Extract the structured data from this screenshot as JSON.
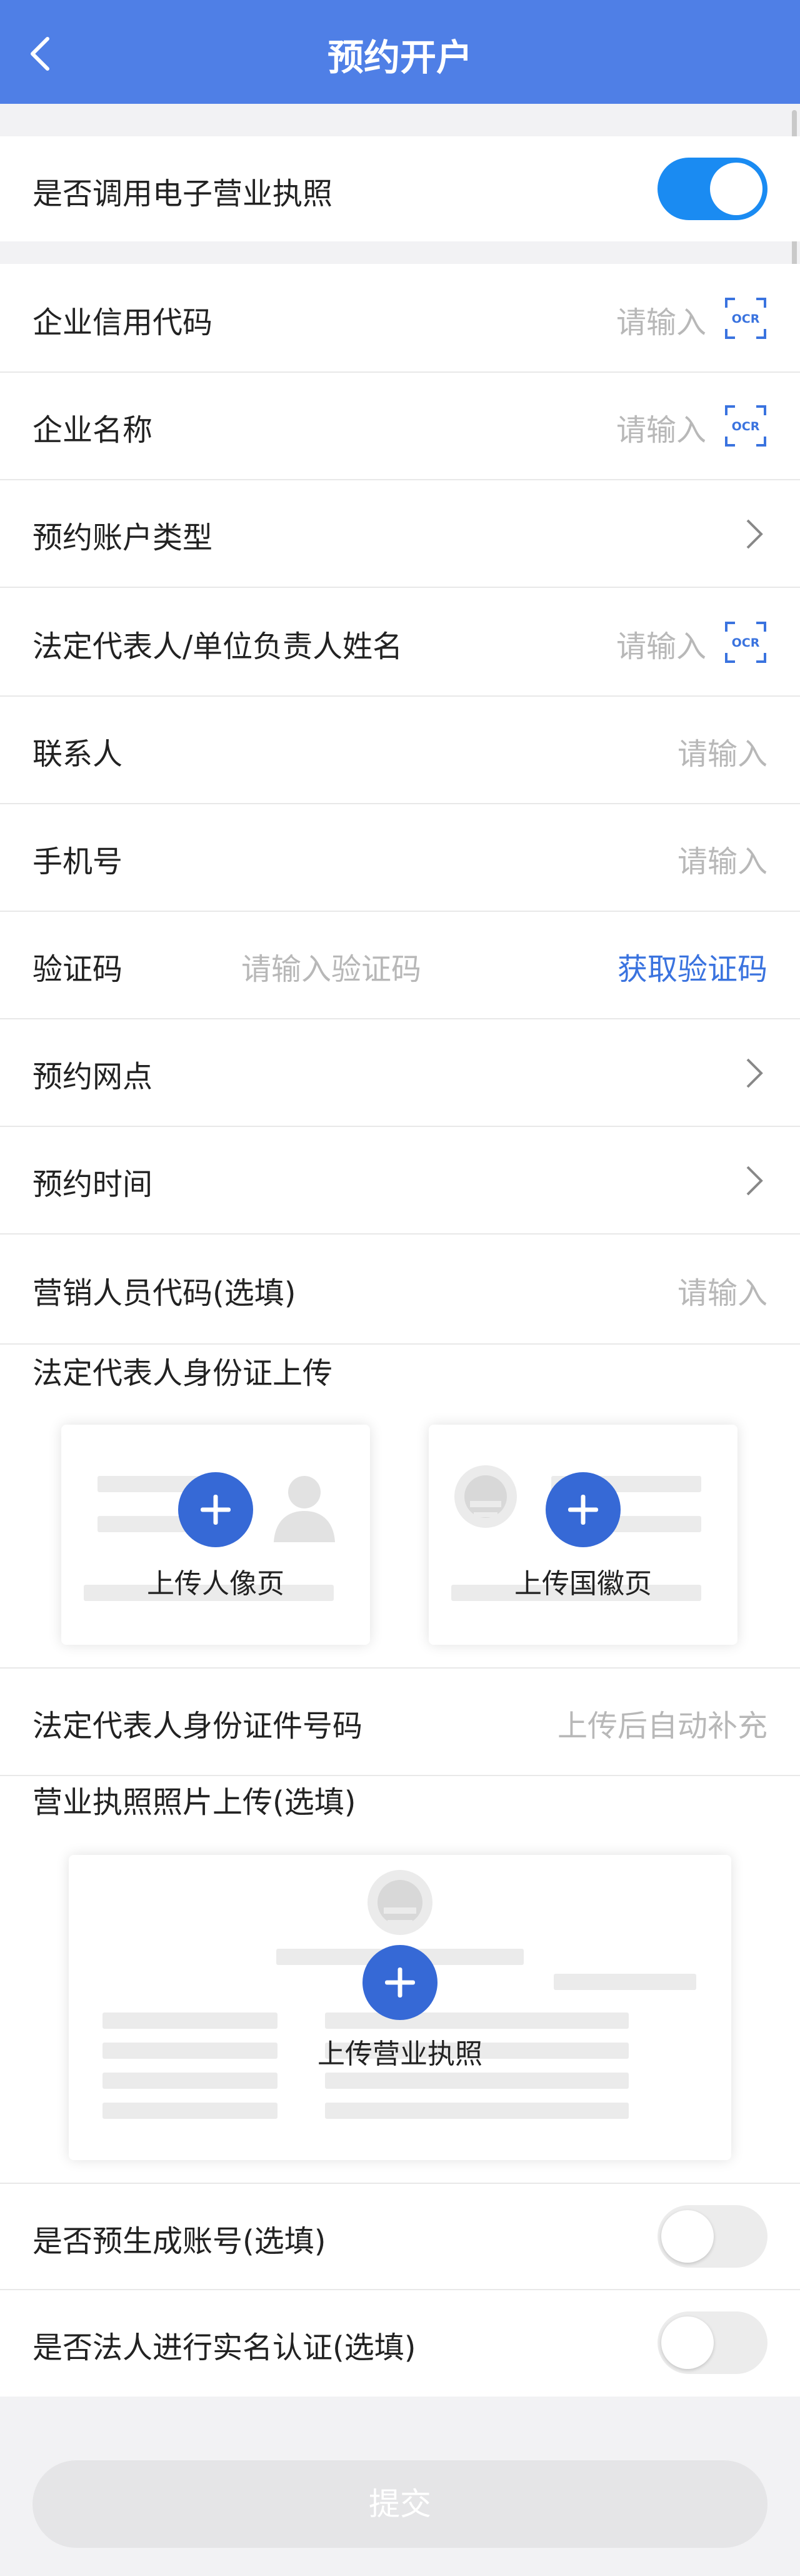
{
  "header": {
    "title": "预约开户"
  },
  "e_license": {
    "label": "是否调用电子营业执照",
    "enabled": true
  },
  "fields": {
    "credit_code": {
      "label": "企业信用代码",
      "placeholder": "请输入",
      "ocr": "OCR"
    },
    "company_name": {
      "label": "企业名称",
      "placeholder": "请输入",
      "ocr": "OCR"
    },
    "account_type": {
      "label": "预约账户类型"
    },
    "legal_rep": {
      "label": "法定代表人/单位负责人姓名",
      "placeholder": "请输入",
      "ocr": "OCR"
    },
    "contact": {
      "label": "联系人",
      "placeholder": "请输入"
    },
    "phone": {
      "label": "手机号",
      "placeholder": "请输入"
    },
    "verify_code": {
      "label": "验证码",
      "placeholder": "请输入验证码",
      "action": "获取验证码"
    },
    "branch": {
      "label": "预约网点"
    },
    "time": {
      "label": "预约时间"
    },
    "marketer_code": {
      "label": "营销人员代码(选填)",
      "placeholder": "请输入"
    }
  },
  "id_upload": {
    "title": "法定代表人身份证上传",
    "portrait_label": "上传人像页",
    "emblem_label": "上传国徽页"
  },
  "id_number": {
    "label": "法定代表人身份证件号码",
    "placeholder": "上传后自动补充"
  },
  "license_upload": {
    "title": "营业执照照片上传(选填)",
    "label": "上传营业执照"
  },
  "pre_account": {
    "label": "是否预生成账号(选填)",
    "enabled": false
  },
  "real_name": {
    "label": "是否法人进行实名认证(选填)",
    "enabled": false
  },
  "submit": {
    "label": "提交"
  },
  "colors": {
    "header": "#4f7fe6",
    "toggle_on": "#1a8bf2",
    "link": "#3a73df",
    "upload_button": "#3669d6"
  }
}
